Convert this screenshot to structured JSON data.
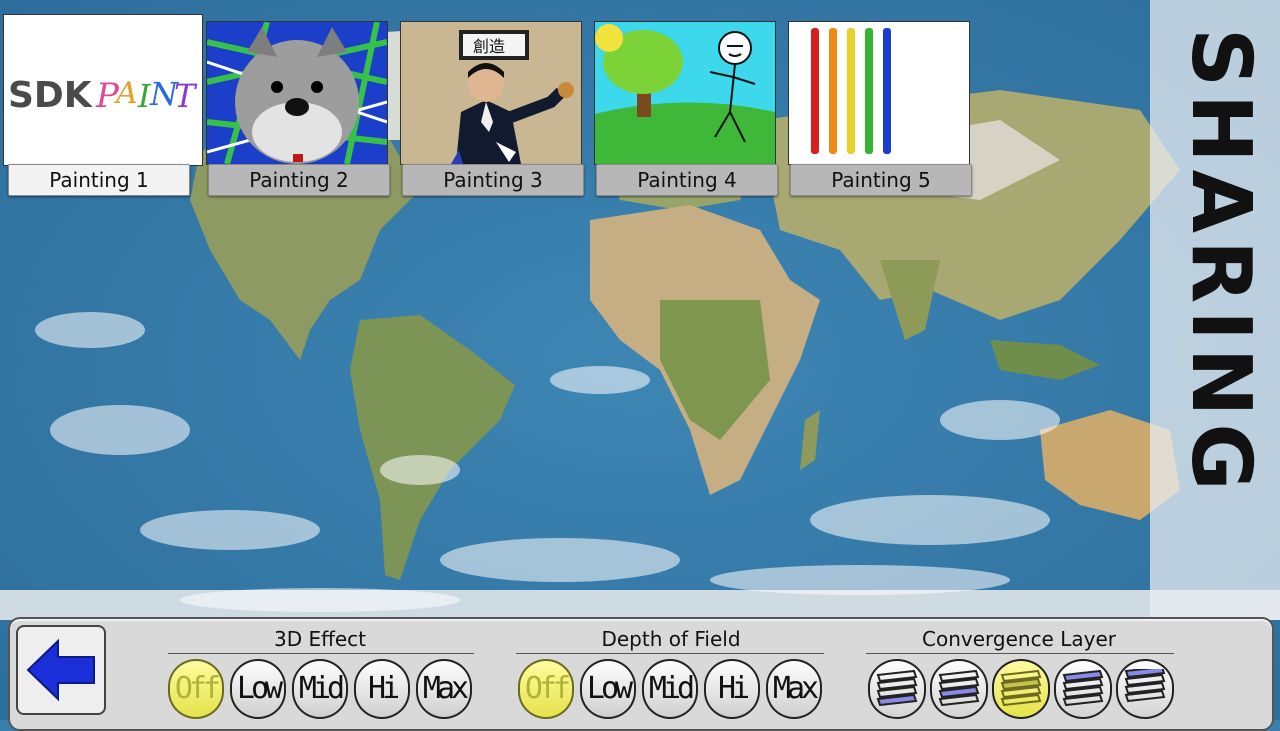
{
  "paintings": [
    {
      "label": "Painting 1",
      "selected": true
    },
    {
      "label": "Painting 2",
      "selected": false
    },
    {
      "label": "Painting 3",
      "selected": false
    },
    {
      "label": "Painting 4",
      "selected": false
    },
    {
      "label": "Painting 5",
      "selected": false
    }
  ],
  "painting1_logo": "SDK PAINT",
  "painting3_sign": "創造",
  "title": "SHARING",
  "controls": {
    "effect3d": {
      "title": "3D Effect",
      "options": [
        "Off",
        "Low",
        "Mid",
        "Hi",
        "Max"
      ],
      "selected": "Off"
    },
    "depth": {
      "title": "Depth of Field",
      "options": [
        "Off",
        "Low",
        "Mid",
        "Hi",
        "Max"
      ],
      "selected": "Off"
    },
    "convergence": {
      "title": "Convergence Layer",
      "count": 5,
      "selected_index": 2
    }
  },
  "colors": {
    "ocean": "#3a7fae",
    "land": "#7f9a5a",
    "active_button": "#f2ef6a",
    "back_arrow": "#1a2fd8"
  },
  "icons": {
    "back": "left-arrow-icon"
  }
}
